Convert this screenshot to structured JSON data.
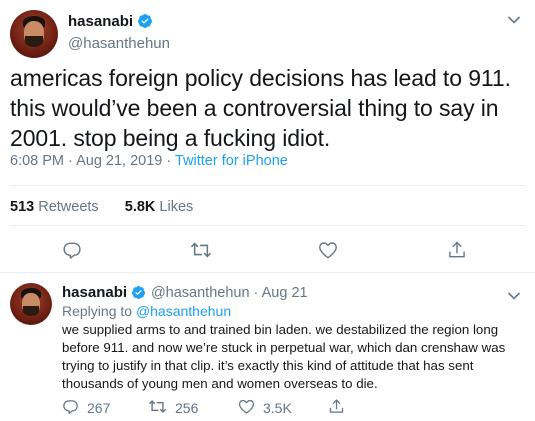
{
  "tweet": {
    "name": "hasanabi",
    "handle": "@hasanthehun",
    "text": "americas foreign policy decisions has lead to 911. this would’ve been a controversial thing to say in 2001. stop being a fucking idiot.",
    "time": "6:08 PM",
    "separator": " · ",
    "date": "Aug 21, 2019",
    "client": "Twitter for iPhone",
    "retweets_count": "513",
    "retweets_label": "Retweets",
    "likes_count": "5.8K",
    "likes_label": "Likes"
  },
  "reply": {
    "name": "hasanabi",
    "handle": "@hasanthehun",
    "separator": " · ",
    "date": "Aug 21",
    "replying_label": "Replying to",
    "replying_handle": "@hasanthehun",
    "text": "we supplied arms to and trained bin laden. we destabilized the region long before 911. and now we’re stuck in perpetual war, which dan crenshaw was trying to justify in that clip. it’s exactly this kind of attitude that has sent thousands of young men and women overseas to die.",
    "reply_count": "267",
    "retweet_count": "256",
    "like_count": "3.5K"
  },
  "colors": {
    "accent": "#1da1f2",
    "muted": "#657786",
    "text": "#14171a",
    "divider": "#e6ecf0"
  },
  "icons": [
    "verified-badge-icon",
    "chevron-down-icon",
    "reply-icon",
    "retweet-icon",
    "like-icon",
    "share-icon"
  ]
}
